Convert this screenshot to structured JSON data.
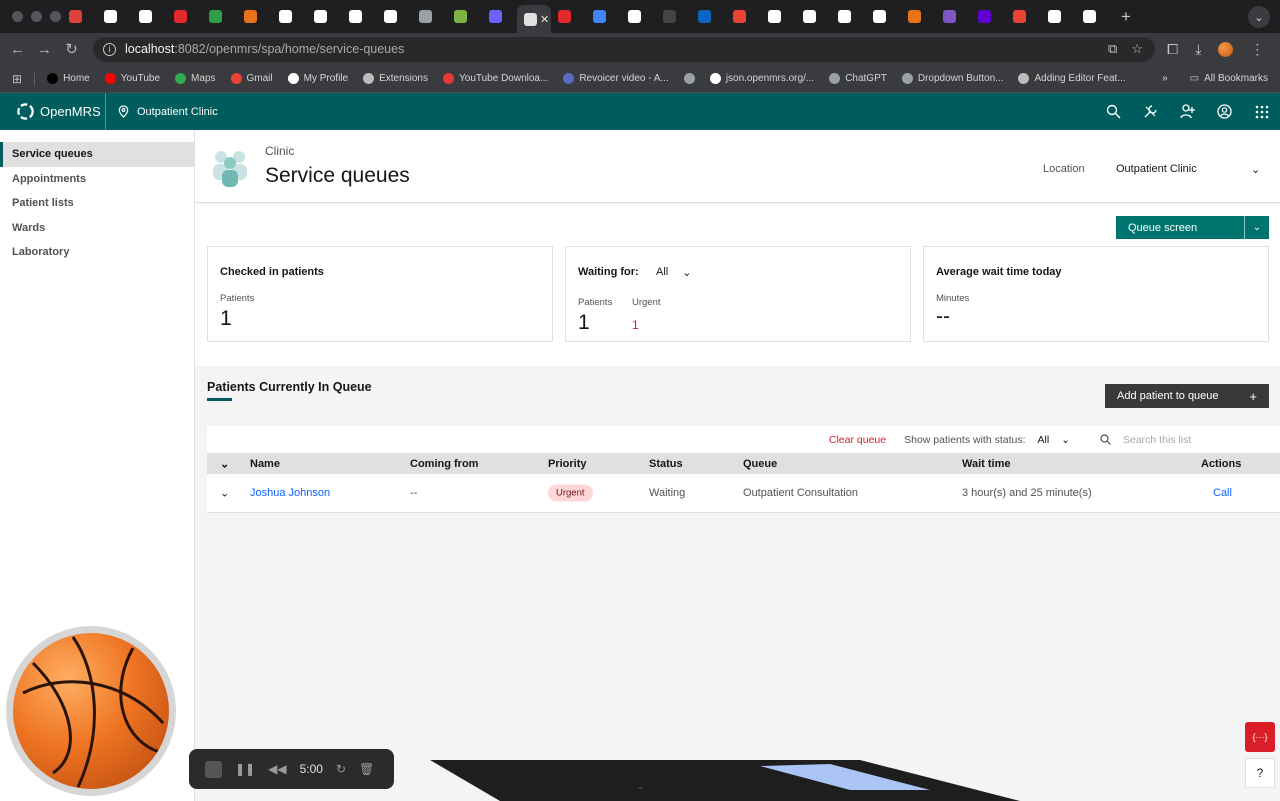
{
  "browser": {
    "tabs": [
      {
        "color": "#e0403a"
      },
      {
        "color": "#ffffff"
      },
      {
        "color": "#ffffff"
      },
      {
        "color": "#e32929"
      },
      {
        "color": "#2f9e44"
      },
      {
        "color": "#e8711a"
      },
      {
        "color": "#ffffff"
      },
      {
        "color": "#ffffff"
      },
      {
        "color": "#ffffff"
      },
      {
        "color": "#ffffff"
      },
      {
        "color": "#9aa0a6"
      },
      {
        "color": "#7cb342"
      },
      {
        "color": "#6c63ff"
      },
      {
        "color": "#e0e0e0",
        "active": true,
        "close_glyph": "✕"
      },
      {
        "color": "#e32929"
      },
      {
        "color": "#4285f4"
      },
      {
        "color": "#ffffff"
      },
      {
        "color": "#444444"
      },
      {
        "color": "#0a66c2"
      },
      {
        "color": "#ea4335"
      },
      {
        "color": "#ffffff"
      },
      {
        "color": "#ffffff"
      },
      {
        "color": "#ffffff"
      },
      {
        "color": "#ffffff"
      },
      {
        "color": "#e8711a"
      },
      {
        "color": "#7e57c2"
      },
      {
        "color": "#6001d2"
      },
      {
        "color": "#ea4335"
      },
      {
        "color": "#ffffff"
      },
      {
        "color": "#ffffff"
      }
    ],
    "url_host": "localhost",
    "url_path": ":8082/openmrs/spa/home/service-queues",
    "bookmarks": [
      {
        "label": "Home",
        "color": "#000000"
      },
      {
        "label": "YouTube",
        "color": "#ff0000"
      },
      {
        "label": "Maps",
        "color": "#34a853"
      },
      {
        "label": "Gmail",
        "color": "#ea4335"
      },
      {
        "label": "My Profile",
        "color": "#ffffff"
      },
      {
        "label": "Extensions",
        "color": "#bbbbbb"
      },
      {
        "label": "YouTube Downloa...",
        "color": "#e53935"
      },
      {
        "label": "Revoicer video - A...",
        "color": "#5c6bc0"
      },
      {
        "label": "",
        "color": "#9aa0a6"
      },
      {
        "label": "json.openmrs.org/...",
        "color": "#ffffff"
      },
      {
        "label": "ChatGPT",
        "color": "#9aa0a6"
      },
      {
        "label": "Dropdown Button...",
        "color": "#9aa0a6"
      },
      {
        "label": "Adding Editor Feat...",
        "color": "#bbbbbb"
      }
    ],
    "all_bookmarks": "All Bookmarks"
  },
  "app": {
    "brand": "OpenMRS",
    "location": "Outpatient Clinic"
  },
  "nav": {
    "items": [
      "Service queues",
      "Appointments",
      "Patient lists",
      "Wards",
      "Laboratory"
    ]
  },
  "page": {
    "breadcrumb": "Clinic",
    "title": "Service queues",
    "location_label": "Location",
    "location_value": "Outpatient Clinic",
    "queue_screen_button": "Queue screen"
  },
  "cards": {
    "checked_in": {
      "title": "Checked in patients",
      "label": "Patients",
      "value": "1"
    },
    "waiting": {
      "title": "Waiting for:",
      "filter": "All",
      "patients_label": "Patients",
      "patients_value": "1",
      "urgent_label": "Urgent",
      "urgent_value": "1"
    },
    "avg_wait": {
      "title": "Average wait time today",
      "label": "Minutes",
      "value": "--"
    }
  },
  "queue": {
    "title": "Patients Currently In Queue",
    "add_button": "Add patient to queue",
    "clear_queue": "Clear queue",
    "status_filter_label": "Show patients with status:",
    "status_filter_value": "All",
    "search_placeholder": "Search this list",
    "columns": [
      "Name",
      "Coming from",
      "Priority",
      "Status",
      "Queue",
      "Wait time",
      "Actions"
    ],
    "rows": [
      {
        "name": "Joshua Johnson",
        "coming_from": "--",
        "priority": "Urgent",
        "status": "Waiting",
        "queue": "Outpatient Consultation",
        "wait_time": "3 hour(s) and 25 minute(s)",
        "action": "Call"
      }
    ]
  },
  "recorder": {
    "time": "5:00"
  },
  "dev_button": "{···}",
  "help_button": "?"
}
